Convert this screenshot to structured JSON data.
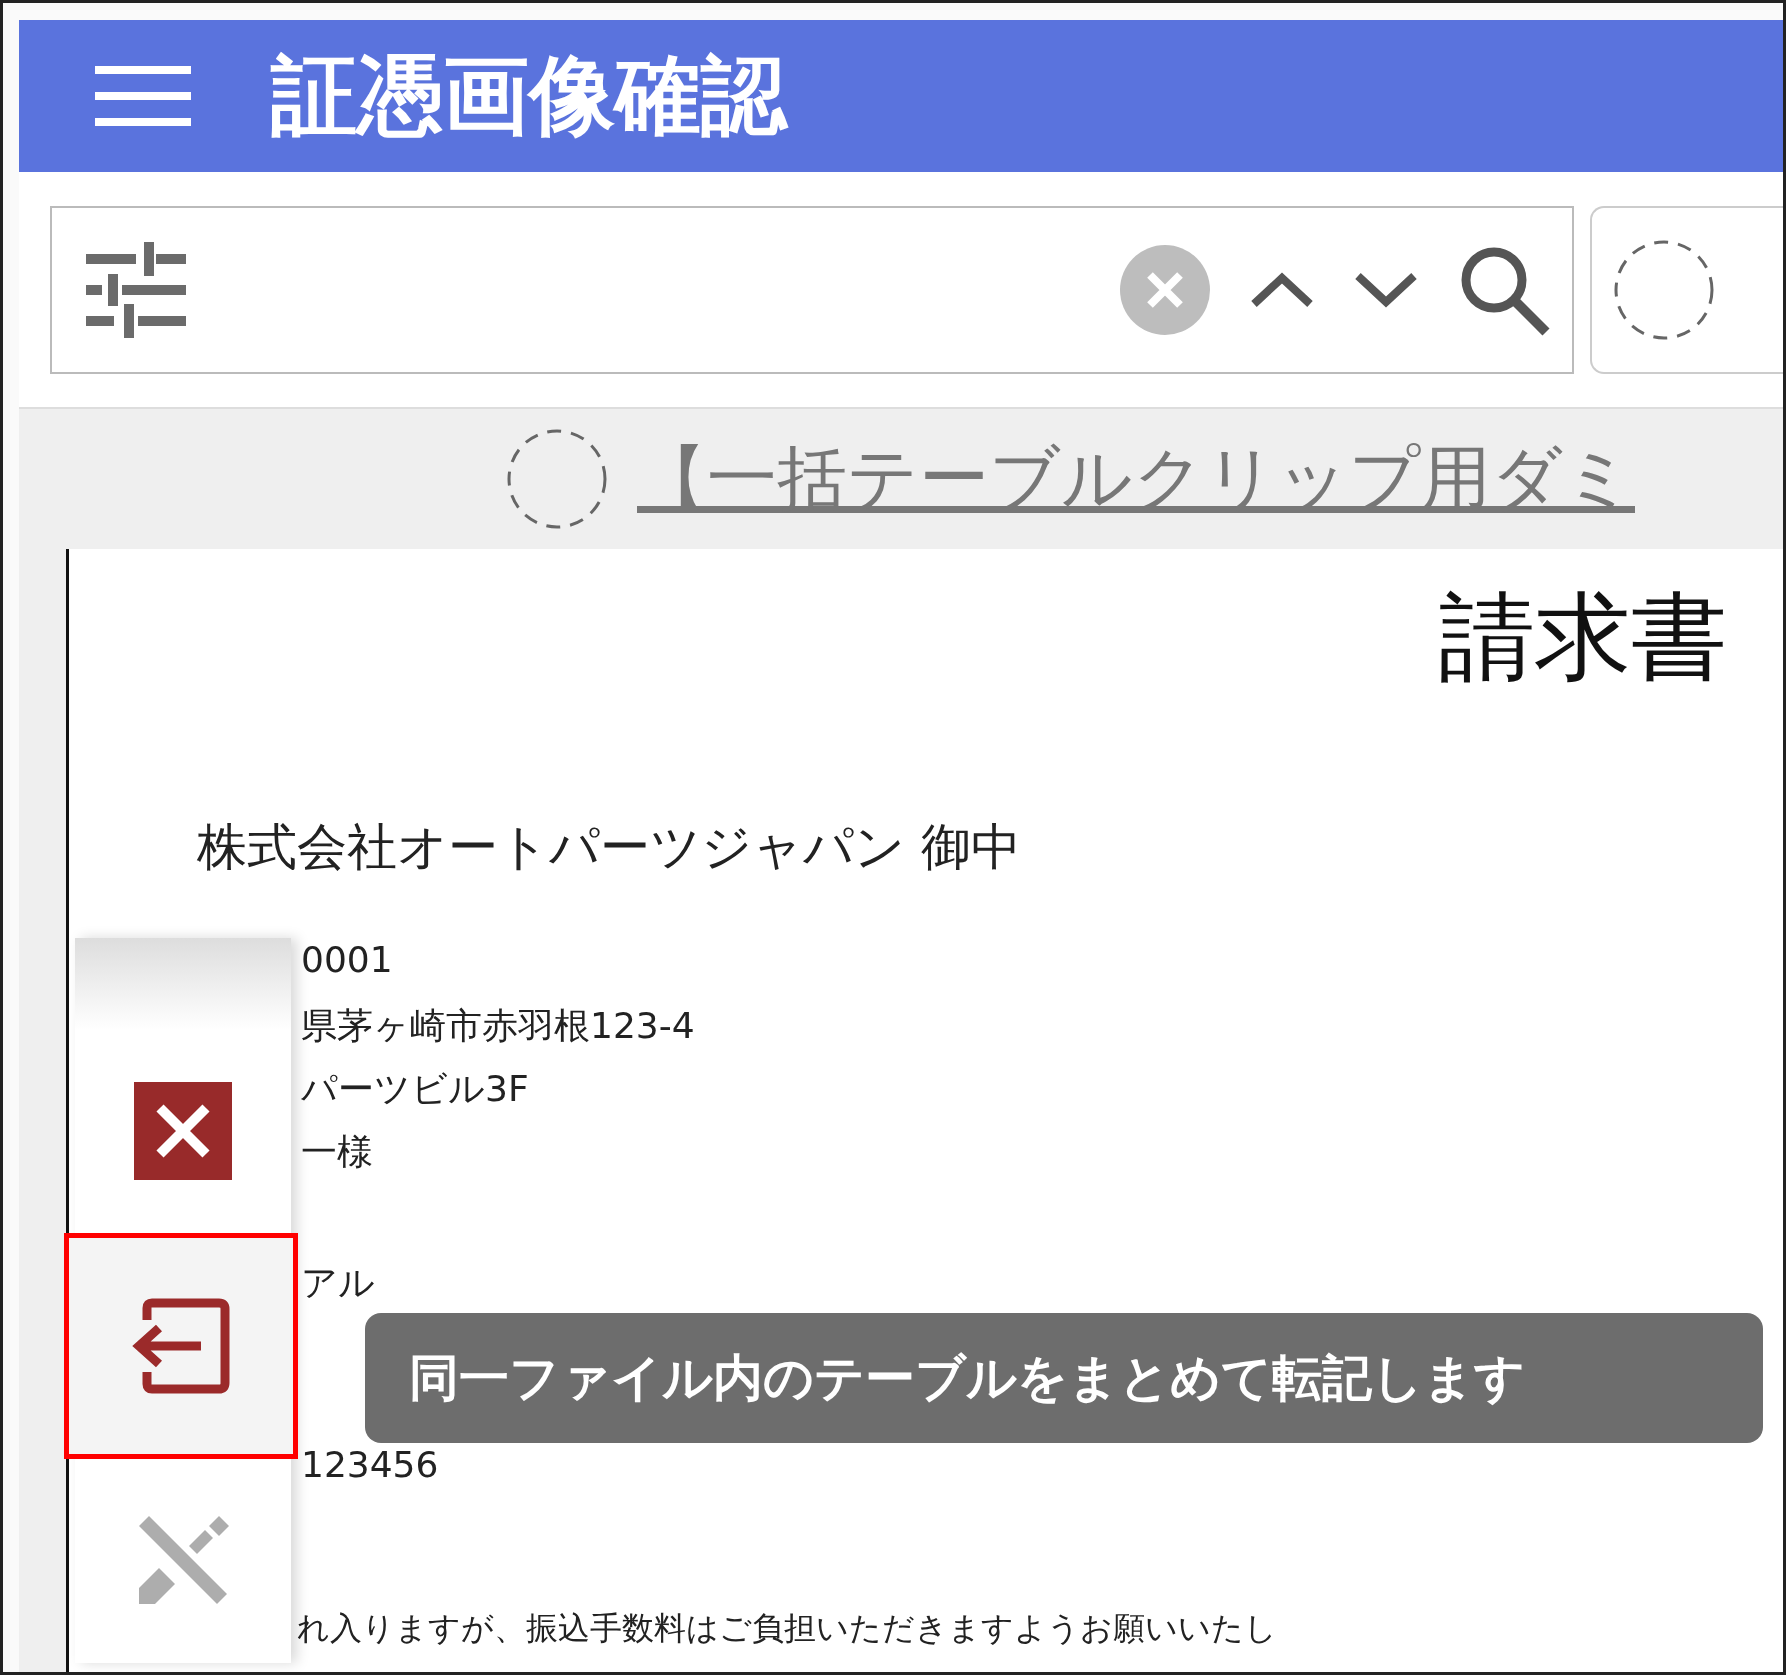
{
  "header": {
    "title": "証憑画像確認"
  },
  "document_link": {
    "text": "【一括テーブルクリップ用ダミ"
  },
  "document": {
    "title": "請求書",
    "addressee": "株式会社オートパーツジャパン 御中",
    "lines": [
      {
        "text": "0001",
        "kind": "address"
      },
      {
        "text": "県茅ヶ崎市赤羽根123-4",
        "kind": "address"
      },
      {
        "text": "パーツビル3F",
        "kind": "address"
      },
      {
        "text": "一様",
        "kind": "address"
      },
      {
        "text": "アル",
        "kind": "bank"
      },
      {
        "text": "123456",
        "kind": "account"
      },
      {
        "text": "れ入りますが、振込手数料はご負担いただきますようお願いいたし",
        "kind": "note"
      }
    ]
  },
  "tool_panel": {
    "buttons": [
      {
        "kind": "close",
        "selected": false,
        "disabled": false
      },
      {
        "kind": "transfer",
        "selected": true,
        "disabled": false
      },
      {
        "kind": "edit-off",
        "selected": false,
        "disabled": true
      }
    ]
  },
  "tooltip": {
    "text": "同一ファイル内のテーブルをまとめて転記します"
  }
}
